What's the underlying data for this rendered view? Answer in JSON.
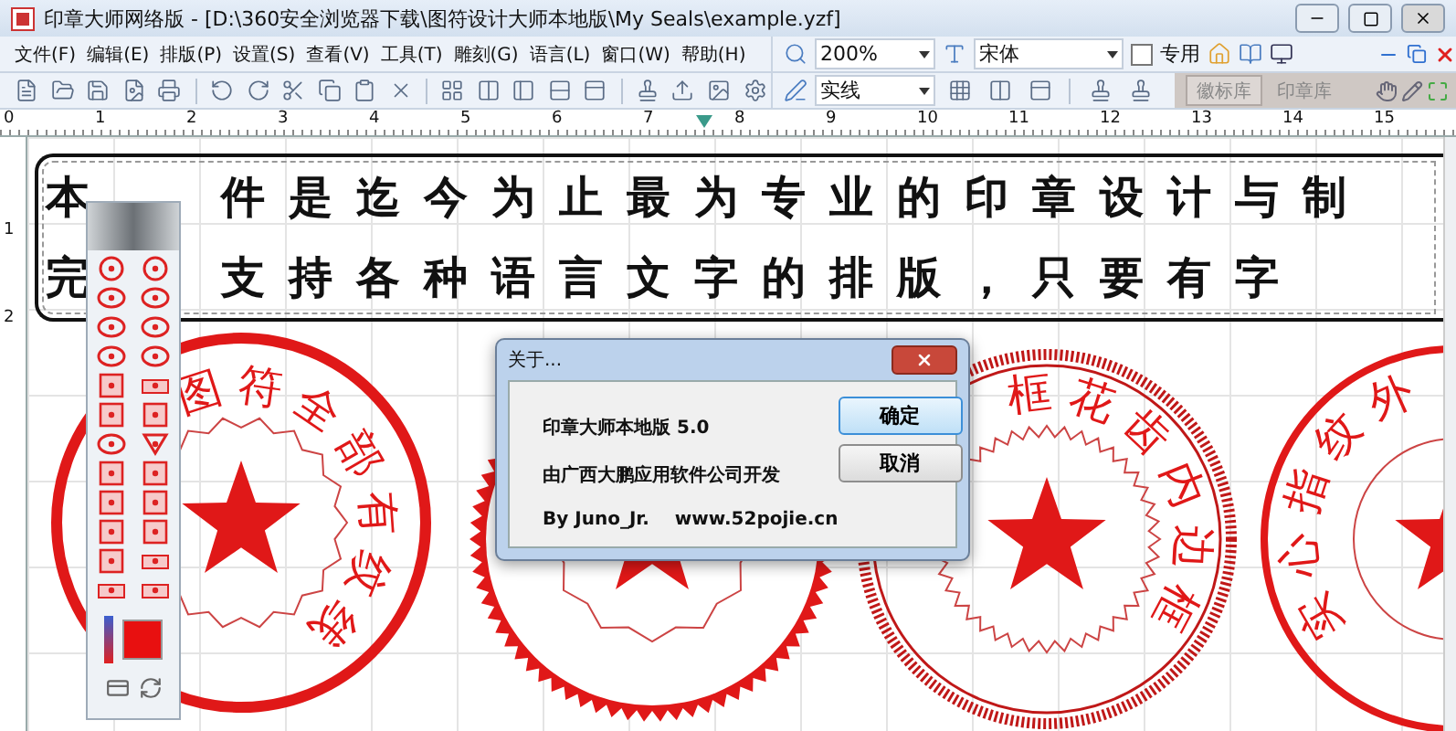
{
  "window": {
    "title": "印章大师网络版 - [D:\\360安全浏览器下载\\图符设计大师本地版\\My Seals\\example.yzf]"
  },
  "menu": [
    "文件(F)",
    "编辑(E)",
    "排版(P)",
    "设置(S)",
    "查看(V)",
    "工具(T)",
    "雕刻(G)",
    "语言(L)",
    "窗口(W)",
    "帮助(H)"
  ],
  "zoom": {
    "value": "200%"
  },
  "font": {
    "value": "宋体"
  },
  "special": {
    "label": "专用",
    "checked": false
  },
  "line_style": {
    "value": "实线"
  },
  "library_tabs": [
    {
      "label": "徽标库",
      "selected": true
    },
    {
      "label": "印章库",
      "selected": false
    }
  ],
  "top_ruler": [
    "0",
    "1",
    "2",
    "3",
    "4",
    "5",
    "6",
    "7",
    "8",
    "9",
    "10",
    "11",
    "12",
    "13",
    "14",
    "15"
  ],
  "left_ruler": [
    "1",
    "2"
  ],
  "banner": [
    [
      "本",
      "件是迄今为止最为专业的印章设计与制"
    ],
    [
      "完",
      "支持各种语言文字的排版，只要有字"
    ]
  ],
  "seals": [
    {
      "kind": "gear",
      "inscription": [
        "图",
        "符",
        "全",
        "部",
        "有",
        "纹",
        "线"
      ]
    },
    {
      "kind": "sawtooth"
    },
    {
      "kind": "hatched",
      "inscription": [
        "框",
        "花",
        "齿",
        "内",
        "边",
        "框"
      ]
    },
    {
      "kind": "plain",
      "inscription": [
        "实",
        "心",
        "指",
        "纹",
        "外"
      ]
    }
  ],
  "dialog": {
    "title": "关于...",
    "lines": [
      "印章大师本地版 5.0",
      "由广西大鹏应用软件公司开发",
      "By Juno_Jr.    www.52pojie.cn"
    ],
    "buttons": [
      {
        "label": "确定",
        "default": true
      },
      {
        "label": "取消",
        "default": false
      }
    ]
  }
}
